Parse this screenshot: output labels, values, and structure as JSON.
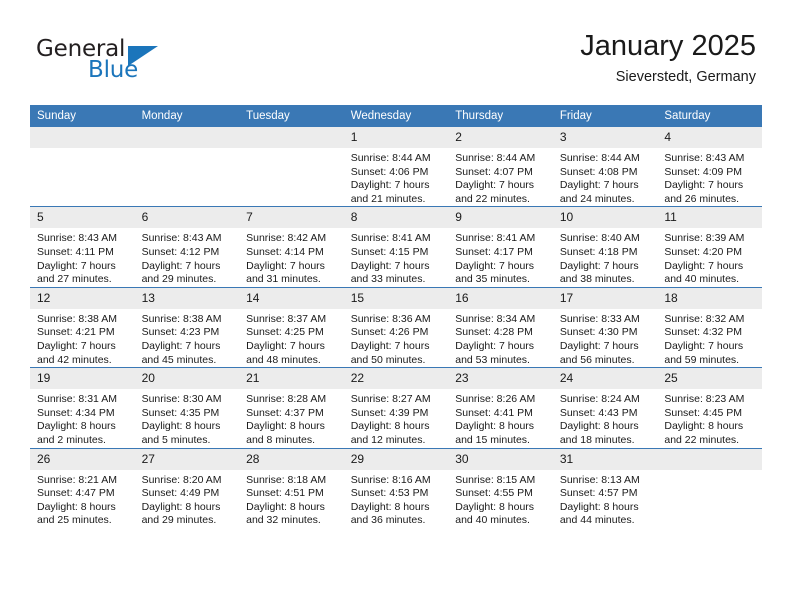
{
  "brand": {
    "name_part1": "General",
    "name_part2": "Blue",
    "colors": {
      "dark": "#231f20",
      "blue": "#1b75bb",
      "header_blue": "#3a78b5",
      "daynum_gray": "#ececec"
    }
  },
  "header": {
    "title": "January 2025",
    "subtitle": "Sieverstedt, Germany"
  },
  "weekday_headers": [
    "Sunday",
    "Monday",
    "Tuesday",
    "Wednesday",
    "Thursday",
    "Friday",
    "Saturday"
  ],
  "weeks": [
    [
      {
        "day": "",
        "sunrise": "",
        "sunset": "",
        "daylight_line1": "",
        "daylight_line2": ""
      },
      {
        "day": "",
        "sunrise": "",
        "sunset": "",
        "daylight_line1": "",
        "daylight_line2": ""
      },
      {
        "day": "",
        "sunrise": "",
        "sunset": "",
        "daylight_line1": "",
        "daylight_line2": ""
      },
      {
        "day": "1",
        "sunrise": "Sunrise: 8:44 AM",
        "sunset": "Sunset: 4:06 PM",
        "daylight_line1": "Daylight: 7 hours",
        "daylight_line2": "and 21 minutes."
      },
      {
        "day": "2",
        "sunrise": "Sunrise: 8:44 AM",
        "sunset": "Sunset: 4:07 PM",
        "daylight_line1": "Daylight: 7 hours",
        "daylight_line2": "and 22 minutes."
      },
      {
        "day": "3",
        "sunrise": "Sunrise: 8:44 AM",
        "sunset": "Sunset: 4:08 PM",
        "daylight_line1": "Daylight: 7 hours",
        "daylight_line2": "and 24 minutes."
      },
      {
        "day": "4",
        "sunrise": "Sunrise: 8:43 AM",
        "sunset": "Sunset: 4:09 PM",
        "daylight_line1": "Daylight: 7 hours",
        "daylight_line2": "and 26 minutes."
      }
    ],
    [
      {
        "day": "5",
        "sunrise": "Sunrise: 8:43 AM",
        "sunset": "Sunset: 4:11 PM",
        "daylight_line1": "Daylight: 7 hours",
        "daylight_line2": "and 27 minutes."
      },
      {
        "day": "6",
        "sunrise": "Sunrise: 8:43 AM",
        "sunset": "Sunset: 4:12 PM",
        "daylight_line1": "Daylight: 7 hours",
        "daylight_line2": "and 29 minutes."
      },
      {
        "day": "7",
        "sunrise": "Sunrise: 8:42 AM",
        "sunset": "Sunset: 4:14 PM",
        "daylight_line1": "Daylight: 7 hours",
        "daylight_line2": "and 31 minutes."
      },
      {
        "day": "8",
        "sunrise": "Sunrise: 8:41 AM",
        "sunset": "Sunset: 4:15 PM",
        "daylight_line1": "Daylight: 7 hours",
        "daylight_line2": "and 33 minutes."
      },
      {
        "day": "9",
        "sunrise": "Sunrise: 8:41 AM",
        "sunset": "Sunset: 4:17 PM",
        "daylight_line1": "Daylight: 7 hours",
        "daylight_line2": "and 35 minutes."
      },
      {
        "day": "10",
        "sunrise": "Sunrise: 8:40 AM",
        "sunset": "Sunset: 4:18 PM",
        "daylight_line1": "Daylight: 7 hours",
        "daylight_line2": "and 38 minutes."
      },
      {
        "day": "11",
        "sunrise": "Sunrise: 8:39 AM",
        "sunset": "Sunset: 4:20 PM",
        "daylight_line1": "Daylight: 7 hours",
        "daylight_line2": "and 40 minutes."
      }
    ],
    [
      {
        "day": "12",
        "sunrise": "Sunrise: 8:38 AM",
        "sunset": "Sunset: 4:21 PM",
        "daylight_line1": "Daylight: 7 hours",
        "daylight_line2": "and 42 minutes."
      },
      {
        "day": "13",
        "sunrise": "Sunrise: 8:38 AM",
        "sunset": "Sunset: 4:23 PM",
        "daylight_line1": "Daylight: 7 hours",
        "daylight_line2": "and 45 minutes."
      },
      {
        "day": "14",
        "sunrise": "Sunrise: 8:37 AM",
        "sunset": "Sunset: 4:25 PM",
        "daylight_line1": "Daylight: 7 hours",
        "daylight_line2": "and 48 minutes."
      },
      {
        "day": "15",
        "sunrise": "Sunrise: 8:36 AM",
        "sunset": "Sunset: 4:26 PM",
        "daylight_line1": "Daylight: 7 hours",
        "daylight_line2": "and 50 minutes."
      },
      {
        "day": "16",
        "sunrise": "Sunrise: 8:34 AM",
        "sunset": "Sunset: 4:28 PM",
        "daylight_line1": "Daylight: 7 hours",
        "daylight_line2": "and 53 minutes."
      },
      {
        "day": "17",
        "sunrise": "Sunrise: 8:33 AM",
        "sunset": "Sunset: 4:30 PM",
        "daylight_line1": "Daylight: 7 hours",
        "daylight_line2": "and 56 minutes."
      },
      {
        "day": "18",
        "sunrise": "Sunrise: 8:32 AM",
        "sunset": "Sunset: 4:32 PM",
        "daylight_line1": "Daylight: 7 hours",
        "daylight_line2": "and 59 minutes."
      }
    ],
    [
      {
        "day": "19",
        "sunrise": "Sunrise: 8:31 AM",
        "sunset": "Sunset: 4:34 PM",
        "daylight_line1": "Daylight: 8 hours",
        "daylight_line2": "and 2 minutes."
      },
      {
        "day": "20",
        "sunrise": "Sunrise: 8:30 AM",
        "sunset": "Sunset: 4:35 PM",
        "daylight_line1": "Daylight: 8 hours",
        "daylight_line2": "and 5 minutes."
      },
      {
        "day": "21",
        "sunrise": "Sunrise: 8:28 AM",
        "sunset": "Sunset: 4:37 PM",
        "daylight_line1": "Daylight: 8 hours",
        "daylight_line2": "and 8 minutes."
      },
      {
        "day": "22",
        "sunrise": "Sunrise: 8:27 AM",
        "sunset": "Sunset: 4:39 PM",
        "daylight_line1": "Daylight: 8 hours",
        "daylight_line2": "and 12 minutes."
      },
      {
        "day": "23",
        "sunrise": "Sunrise: 8:26 AM",
        "sunset": "Sunset: 4:41 PM",
        "daylight_line1": "Daylight: 8 hours",
        "daylight_line2": "and 15 minutes."
      },
      {
        "day": "24",
        "sunrise": "Sunrise: 8:24 AM",
        "sunset": "Sunset: 4:43 PM",
        "daylight_line1": "Daylight: 8 hours",
        "daylight_line2": "and 18 minutes."
      },
      {
        "day": "25",
        "sunrise": "Sunrise: 8:23 AM",
        "sunset": "Sunset: 4:45 PM",
        "daylight_line1": "Daylight: 8 hours",
        "daylight_line2": "and 22 minutes."
      }
    ],
    [
      {
        "day": "26",
        "sunrise": "Sunrise: 8:21 AM",
        "sunset": "Sunset: 4:47 PM",
        "daylight_line1": "Daylight: 8 hours",
        "daylight_line2": "and 25 minutes."
      },
      {
        "day": "27",
        "sunrise": "Sunrise: 8:20 AM",
        "sunset": "Sunset: 4:49 PM",
        "daylight_line1": "Daylight: 8 hours",
        "daylight_line2": "and 29 minutes."
      },
      {
        "day": "28",
        "sunrise": "Sunrise: 8:18 AM",
        "sunset": "Sunset: 4:51 PM",
        "daylight_line1": "Daylight: 8 hours",
        "daylight_line2": "and 32 minutes."
      },
      {
        "day": "29",
        "sunrise": "Sunrise: 8:16 AM",
        "sunset": "Sunset: 4:53 PM",
        "daylight_line1": "Daylight: 8 hours",
        "daylight_line2": "and 36 minutes."
      },
      {
        "day": "30",
        "sunrise": "Sunrise: 8:15 AM",
        "sunset": "Sunset: 4:55 PM",
        "daylight_line1": "Daylight: 8 hours",
        "daylight_line2": "and 40 minutes."
      },
      {
        "day": "31",
        "sunrise": "Sunrise: 8:13 AM",
        "sunset": "Sunset: 4:57 PM",
        "daylight_line1": "Daylight: 8 hours",
        "daylight_line2": "and 44 minutes."
      },
      {
        "day": "",
        "sunrise": "",
        "sunset": "",
        "daylight_line1": "",
        "daylight_line2": ""
      }
    ]
  ]
}
